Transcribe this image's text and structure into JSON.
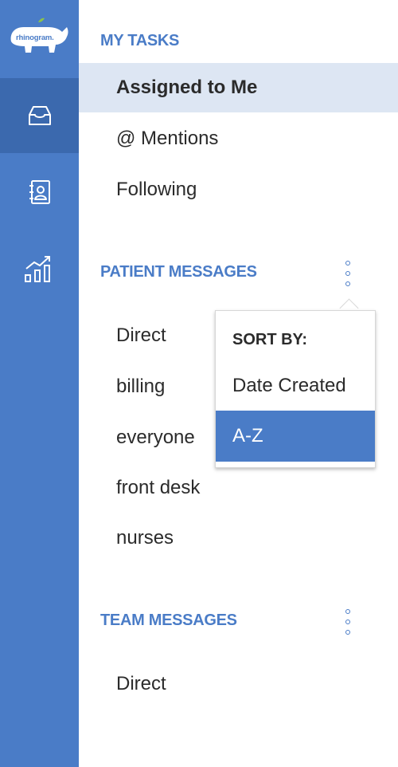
{
  "brand": {
    "logo_text": "rhinogram."
  },
  "colors": {
    "rail": "#4a7cc7",
    "rail_active": "#3b69ae",
    "accent": "#4a7cc7",
    "active_item_bg": "#dde6f3"
  },
  "rail": {
    "items": [
      {
        "icon": "inbox-icon",
        "active": true
      },
      {
        "icon": "contacts-icon",
        "active": false
      },
      {
        "icon": "analytics-icon",
        "active": false
      }
    ]
  },
  "my_tasks": {
    "title": "MY TASKS",
    "items": [
      {
        "label": "Assigned to Me",
        "active": true
      },
      {
        "label": "@ Mentions",
        "active": false
      },
      {
        "label": "Following",
        "active": false
      }
    ]
  },
  "patient_messages": {
    "title": "PATIENT MESSAGES",
    "items": [
      {
        "label": "Direct"
      },
      {
        "label": "billing"
      },
      {
        "label": "everyone"
      },
      {
        "label": "front desk"
      },
      {
        "label": "nurses"
      }
    ]
  },
  "sort_menu": {
    "header": "SORT BY:",
    "options": [
      {
        "label": "Date Created",
        "selected": false
      },
      {
        "label": "A-Z",
        "selected": true
      }
    ]
  },
  "team_messages": {
    "title": "TEAM MESSAGES",
    "items": [
      {
        "label": "Direct"
      }
    ]
  }
}
